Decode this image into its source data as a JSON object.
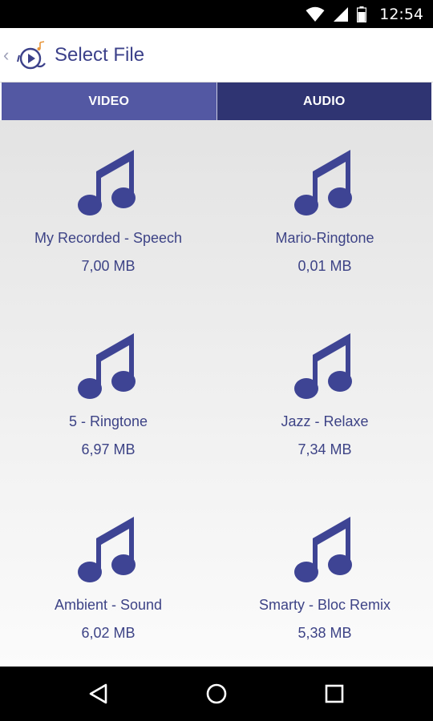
{
  "status_bar": {
    "time": "12:54",
    "icons": [
      "wifi-icon",
      "signal-icon",
      "battery-icon"
    ]
  },
  "app_bar": {
    "title": "Select File",
    "back_icon": "chevron-left-icon",
    "logo_icon": "play-music-logo-icon"
  },
  "tabs": [
    {
      "label": "VIDEO",
      "active": false
    },
    {
      "label": "AUDIO",
      "active": true
    }
  ],
  "files": [
    {
      "name": "My Recorded - Speech",
      "size": "7,00 MB",
      "icon": "music-note-icon"
    },
    {
      "name": "Mario-Ringtone",
      "size": "0,01 MB",
      "icon": "music-note-icon"
    },
    {
      "name": "5 - Ringtone",
      "size": "6,97 MB",
      "icon": "music-note-icon"
    },
    {
      "name": "Jazz - Relaxe",
      "size": "7,34 MB",
      "icon": "music-note-icon"
    },
    {
      "name": "Ambient - Sound",
      "size": "6,02 MB",
      "icon": "music-note-icon"
    },
    {
      "name": "Smarty - Bloc Remix",
      "size": "5,38 MB",
      "icon": "music-note-icon"
    }
  ],
  "nav_bar": {
    "buttons": [
      "back-triangle-icon",
      "home-circle-icon",
      "recents-square-icon"
    ]
  },
  "colors": {
    "accent": "#3c418a",
    "tab_video": "#5358a3",
    "tab_audio": "#2f3472",
    "note": "#3e4494"
  }
}
